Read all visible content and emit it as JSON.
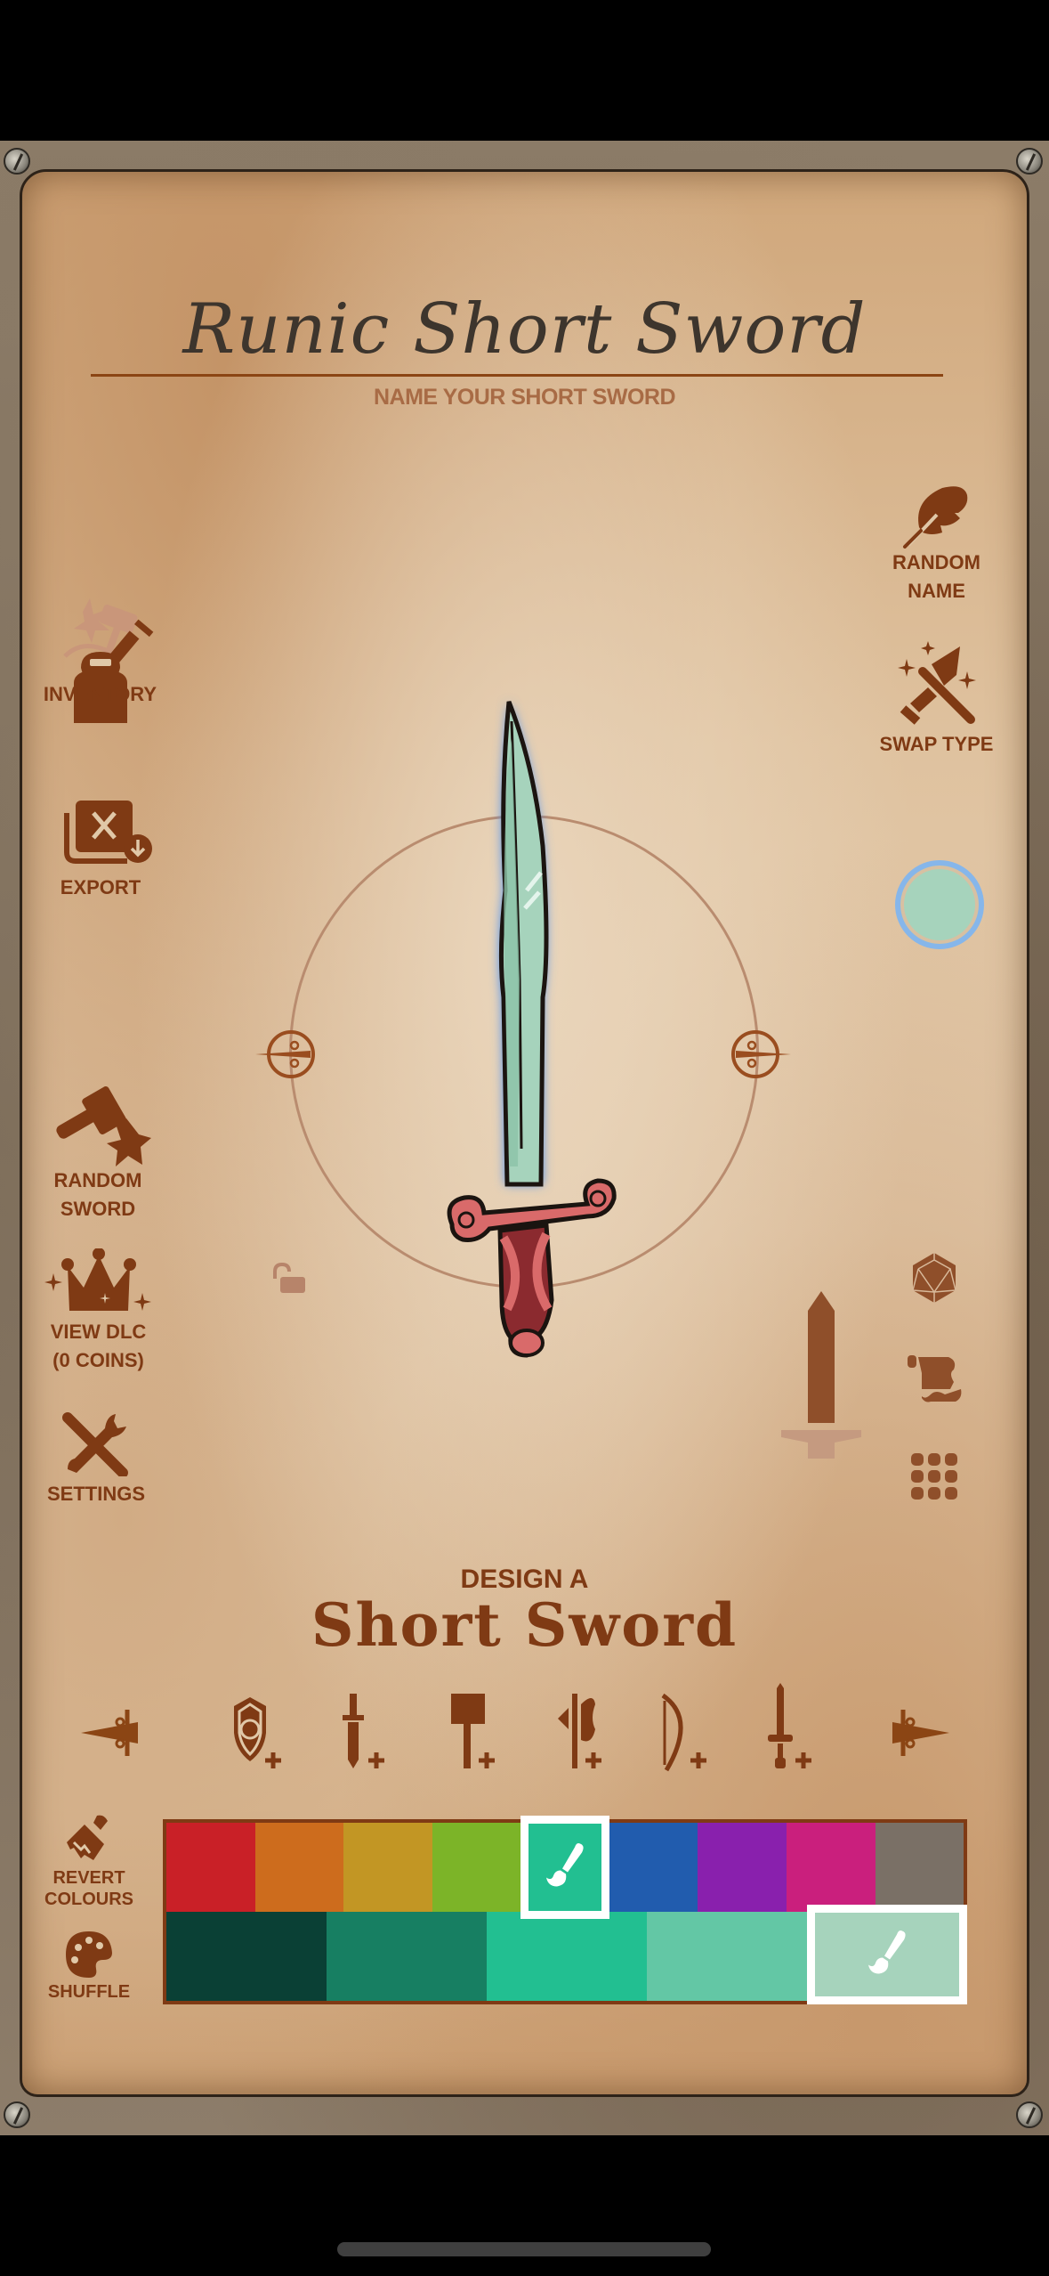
{
  "header": {
    "sword_name": "Runic Short Sword",
    "name_prompt": "NAME YOUR SHORT SWORD"
  },
  "left_menu": [
    {
      "id": "inventory",
      "label": "INVENTORY",
      "icon": "backpack-icon"
    },
    {
      "id": "export",
      "label": "EXPORT",
      "icon": "export-image-icon"
    },
    {
      "id": "random-sword",
      "label_line1": "RANDOM",
      "label_line2": "SWORD",
      "icon": "hammer-anvil-icon"
    },
    {
      "id": "view-dlc",
      "label_line1": "VIEW DLC",
      "label_line2": "(0 COINS)",
      "icon": "crown-icon"
    },
    {
      "id": "settings",
      "label": "SETTINGS",
      "icon": "tools-icon"
    }
  ],
  "right_menu": [
    {
      "id": "random-name",
      "label_line1": "RANDOM",
      "label_line2": "NAME",
      "icon": "quill-icon"
    },
    {
      "id": "swap-type",
      "label": "SWAP TYPE",
      "icon": "crossed-weapons-icon"
    }
  ],
  "current_colour": "#a6d3bc",
  "right_tools": [
    "d20-dice-icon",
    "scroll-icon",
    "grid-icon"
  ],
  "preview": {
    "blade_color": "#a6d3bc",
    "guard_color": "#d96a6a",
    "grip_color": "#8b2a2f",
    "glow_color": "#4a8ff0"
  },
  "design": {
    "prefix": "DESIGN A",
    "type": "Short Sword"
  },
  "parts_bar": {
    "items": [
      "shield-add-icon",
      "dagger-add-icon",
      "hammer-add-icon",
      "axe-add-icon",
      "bow-add-icon",
      "sword-add-icon"
    ]
  },
  "palette": {
    "revert_label_line1": "REVERT",
    "revert_label_line2": "COLOURS",
    "shuffle_label": "SHUFFLE",
    "hues": [
      {
        "name": "red",
        "hex": "#c92027",
        "selected": false
      },
      {
        "name": "orange",
        "hex": "#cd6c1d",
        "selected": false
      },
      {
        "name": "mustard",
        "hex": "#c29624",
        "selected": false
      },
      {
        "name": "lime",
        "hex": "#7cb428",
        "selected": false
      },
      {
        "name": "teal",
        "hex": "#22bf91",
        "selected": true
      },
      {
        "name": "blue",
        "hex": "#215cae",
        "selected": false
      },
      {
        "name": "purple",
        "hex": "#8920ad",
        "selected": false
      },
      {
        "name": "magenta",
        "hex": "#ca1f7d",
        "selected": false
      },
      {
        "name": "grey",
        "hex": "#7a7066",
        "selected": false
      }
    ],
    "shades": [
      {
        "hex": "#0a4035",
        "selected": false
      },
      {
        "hex": "#177f62",
        "selected": false
      },
      {
        "hex": "#22bf91",
        "selected": false
      },
      {
        "hex": "#63c7a5",
        "selected": false
      },
      {
        "hex": "#a6d3bc",
        "selected": true
      }
    ]
  }
}
